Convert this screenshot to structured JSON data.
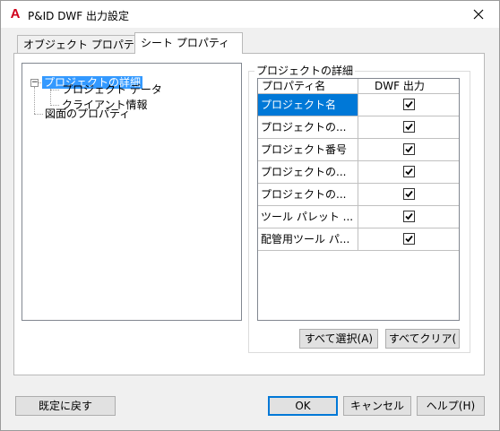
{
  "window": {
    "title": "P&ID DWF 出力設定",
    "app_icon": "A",
    "close_glyph": "✕"
  },
  "tabs": [
    {
      "label": "オブジェクト プロパティ",
      "active": false
    },
    {
      "label": "シート プロパティ",
      "active": true
    }
  ],
  "tree": {
    "root": {
      "label": "プロジェクトの詳細",
      "expander": "−",
      "selected": true
    },
    "children": [
      "プロジェクト データ",
      "クライアント情報"
    ],
    "second_root": "図面のプロパティ"
  },
  "group": {
    "label": "プロジェクトの詳細",
    "columns": {
      "name": "プロパティ名",
      "dwf": "DWF 出力"
    },
    "rows": [
      {
        "name": "プロジェクト名",
        "checked": true,
        "selected": true
      },
      {
        "name": "プロジェクトの...",
        "checked": true,
        "selected": false
      },
      {
        "name": "プロジェクト番号",
        "checked": true,
        "selected": false
      },
      {
        "name": "プロジェクトの...",
        "checked": true,
        "selected": false
      },
      {
        "name": "プロジェクトの...",
        "checked": true,
        "selected": false
      },
      {
        "name": "ツール パレット ...",
        "checked": true,
        "selected": false
      },
      {
        "name": "配管用ツール パ...",
        "checked": true,
        "selected": false
      }
    ],
    "select_all": "すべて選択(A)",
    "clear_all": "すべてクリア("
  },
  "footer": {
    "reset": "既定に戻す",
    "ok": "OK",
    "cancel": "キャンセル",
    "help": "ヘルプ(H)"
  },
  "colors": {
    "selection": "#3399ff",
    "cell_selection": "#0078d7",
    "app_icon": "#d0021b"
  }
}
